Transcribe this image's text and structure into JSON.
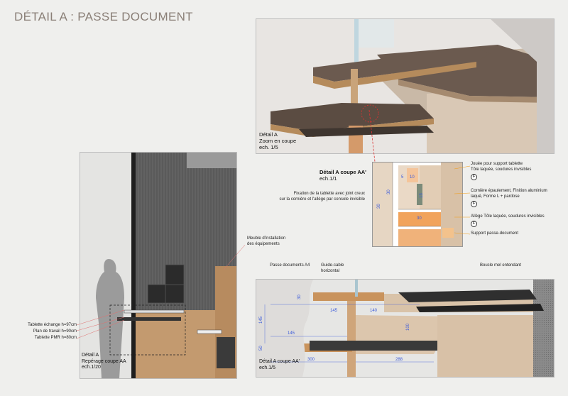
{
  "title": "DÉTAIL A : PASSE DOCUMENT",
  "zoom_panel": {
    "caption": [
      "Détail A",
      "Zoom en coupe",
      "ech. 1/5"
    ]
  },
  "section_detail": {
    "caption": [
      "Détail A coupe AA'",
      "ech.1/1"
    ],
    "dims": [
      "5",
      "10",
      "30",
      "13",
      "30",
      "30"
    ],
    "left_note": [
      "Fixation de la tablette avec joint creux",
      "sur la cornière et l'allège par console invisible"
    ],
    "right_notes": [
      [
        "Jouée pour support tablette",
        "Tôle laquée, soudures invisibles"
      ],
      [
        "Cornière épaulement, Finition aluminium",
        "laqué, Forme L + pardose"
      ],
      [
        "Allège Tôle laquée, soudures invisibles"
      ],
      [
        "Support passe-document"
      ]
    ],
    "f_mark": "F"
  },
  "elevation": {
    "levels": [
      "Tablette échange h=97cm",
      "Plan de travail h=90cm",
      "Tablette PMR h=80cm"
    ],
    "caption": [
      "Détail A",
      "Repérage coupe AA",
      "ech.1/20"
    ],
    "furniture_note": [
      "Meuble d'installation",
      "des équipements"
    ]
  },
  "section_15": {
    "callouts": [
      "Passe documents A4",
      "Guide-cable",
      "horizontal",
      "Boucle mel entendant"
    ],
    "dims": [
      "30",
      "145",
      "140",
      "145",
      "145",
      "100",
      "50",
      "300",
      "288"
    ],
    "caption": [
      "Détail A coupe AA'",
      "ech.1/5"
    ]
  }
}
